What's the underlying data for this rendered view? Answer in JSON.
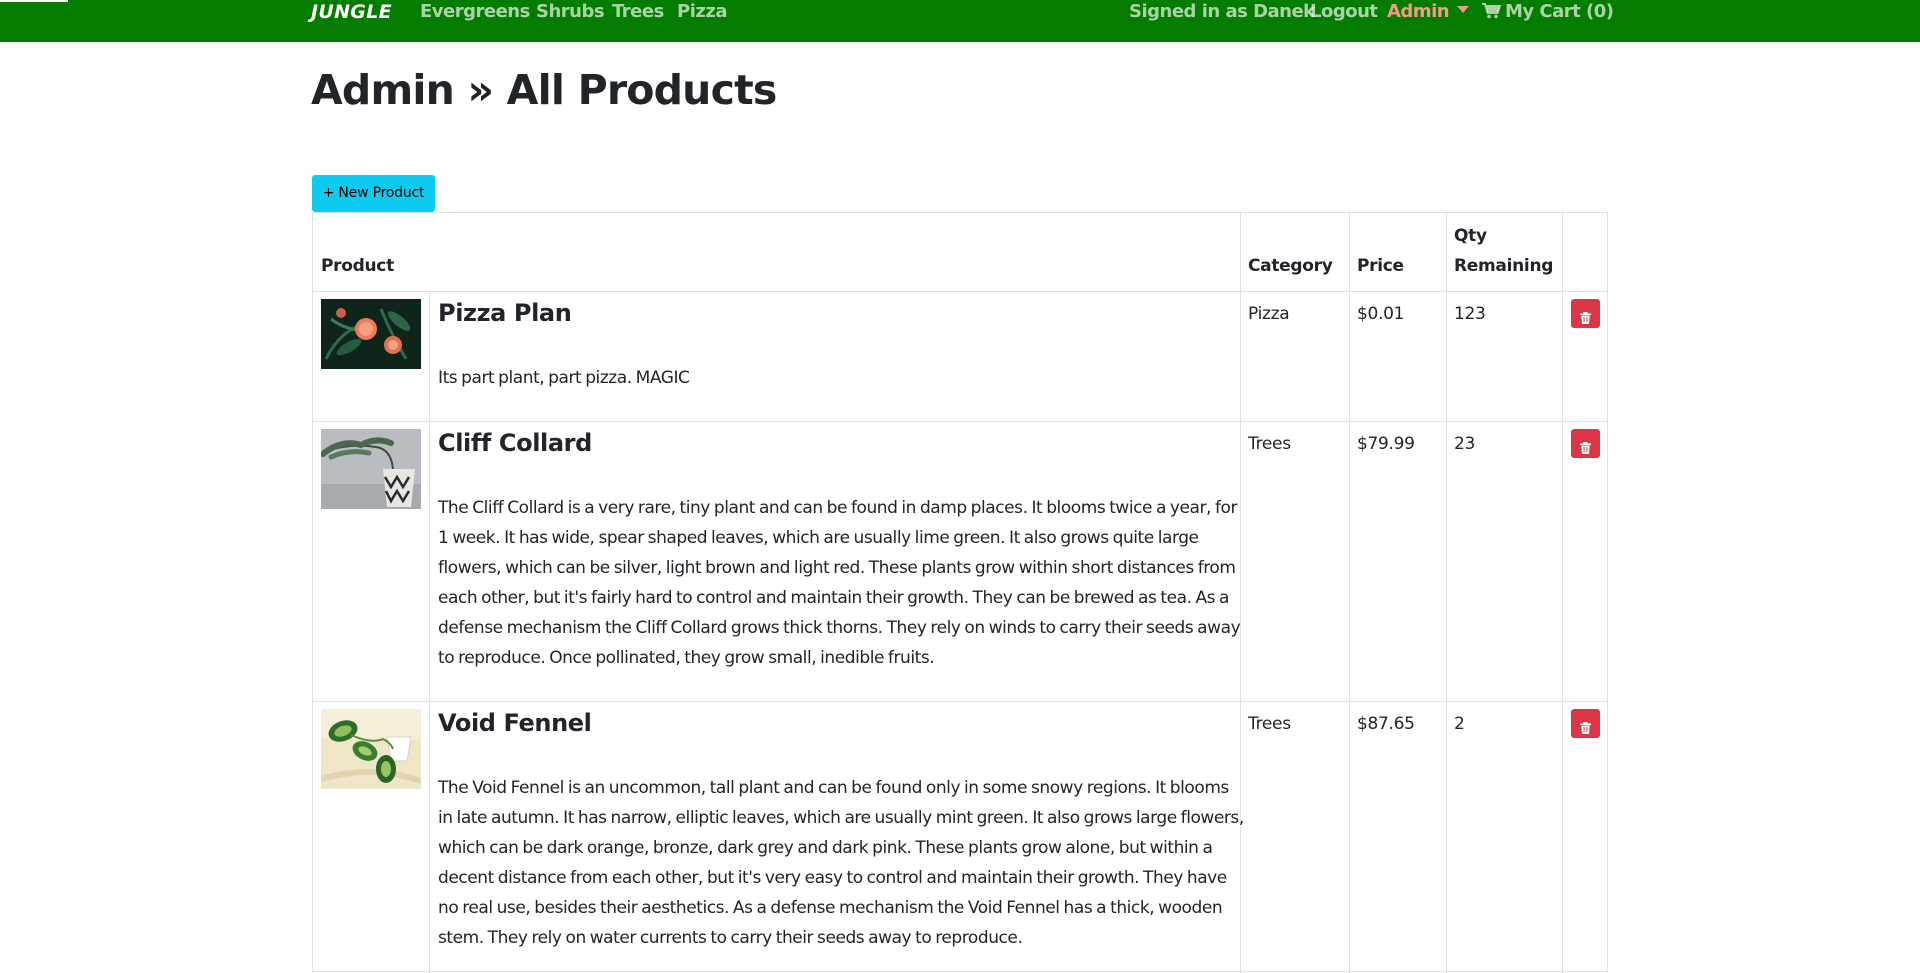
{
  "navbar": {
    "brand": "JUNGLE",
    "links": [
      "Evergreens",
      "Shrubs",
      "Trees",
      "Pizza"
    ],
    "signed_in": "Signed in as Danek",
    "logout": "Logout",
    "admin": "Admin",
    "cart": "My Cart (0)",
    "bg_color": "#037c00"
  },
  "page": {
    "title": "Admin » All Products"
  },
  "new_product_button": "+ New Product",
  "table": {
    "headers": {
      "product": "Product",
      "category": "Category",
      "price": "Price",
      "qty": "Qty Remaining"
    },
    "rows": [
      {
        "name": "Pizza Plan",
        "description": "Its part plant, part pizza. MAGIC",
        "category": "Pizza",
        "price": "$0.01",
        "qty": "123"
      },
      {
        "name": "Cliff Collard",
        "description": "The Cliff Collard is a very rare, tiny plant and can be found in damp places. It blooms twice a year, for 1 week. It has wide, spear shaped leaves, which are usually lime green. It also grows quite large flowers, which can be silver, light brown and light red. These plants grow within short distances from each other, but it's fairly hard to control and maintain their growth. They can be brewed as tea. As a defense mechanism the Cliff Collard grows thick thorns. They rely on winds to carry their seeds away to reproduce. Once pollinated, they grow small, inedible fruits.",
        "category": "Trees",
        "price": "$79.99",
        "qty": "23"
      },
      {
        "name": "Void Fennel",
        "description": "The Void Fennel is an uncommon, tall plant and can be found only in some snowy regions. It blooms in late autumn. It has narrow, elliptic leaves, which are usually mint green. It also grows large flowers, which can be dark orange, bronze, dark grey and dark pink. These plants grow alone, but within a decent distance from each other, but it's very easy to control and maintain their growth. They have no real use, besides their aesthetics. As a defense mechanism the Void Fennel has a thick, wooden stem. They rely on water currents to carry their seeds away to reproduce.",
        "category": "Trees",
        "price": "$87.65",
        "qty": "2"
      }
    ]
  },
  "colors": {
    "accent_button": "#0dcaf0",
    "danger": "#dc3545",
    "admin_link": "#f59a8a"
  }
}
